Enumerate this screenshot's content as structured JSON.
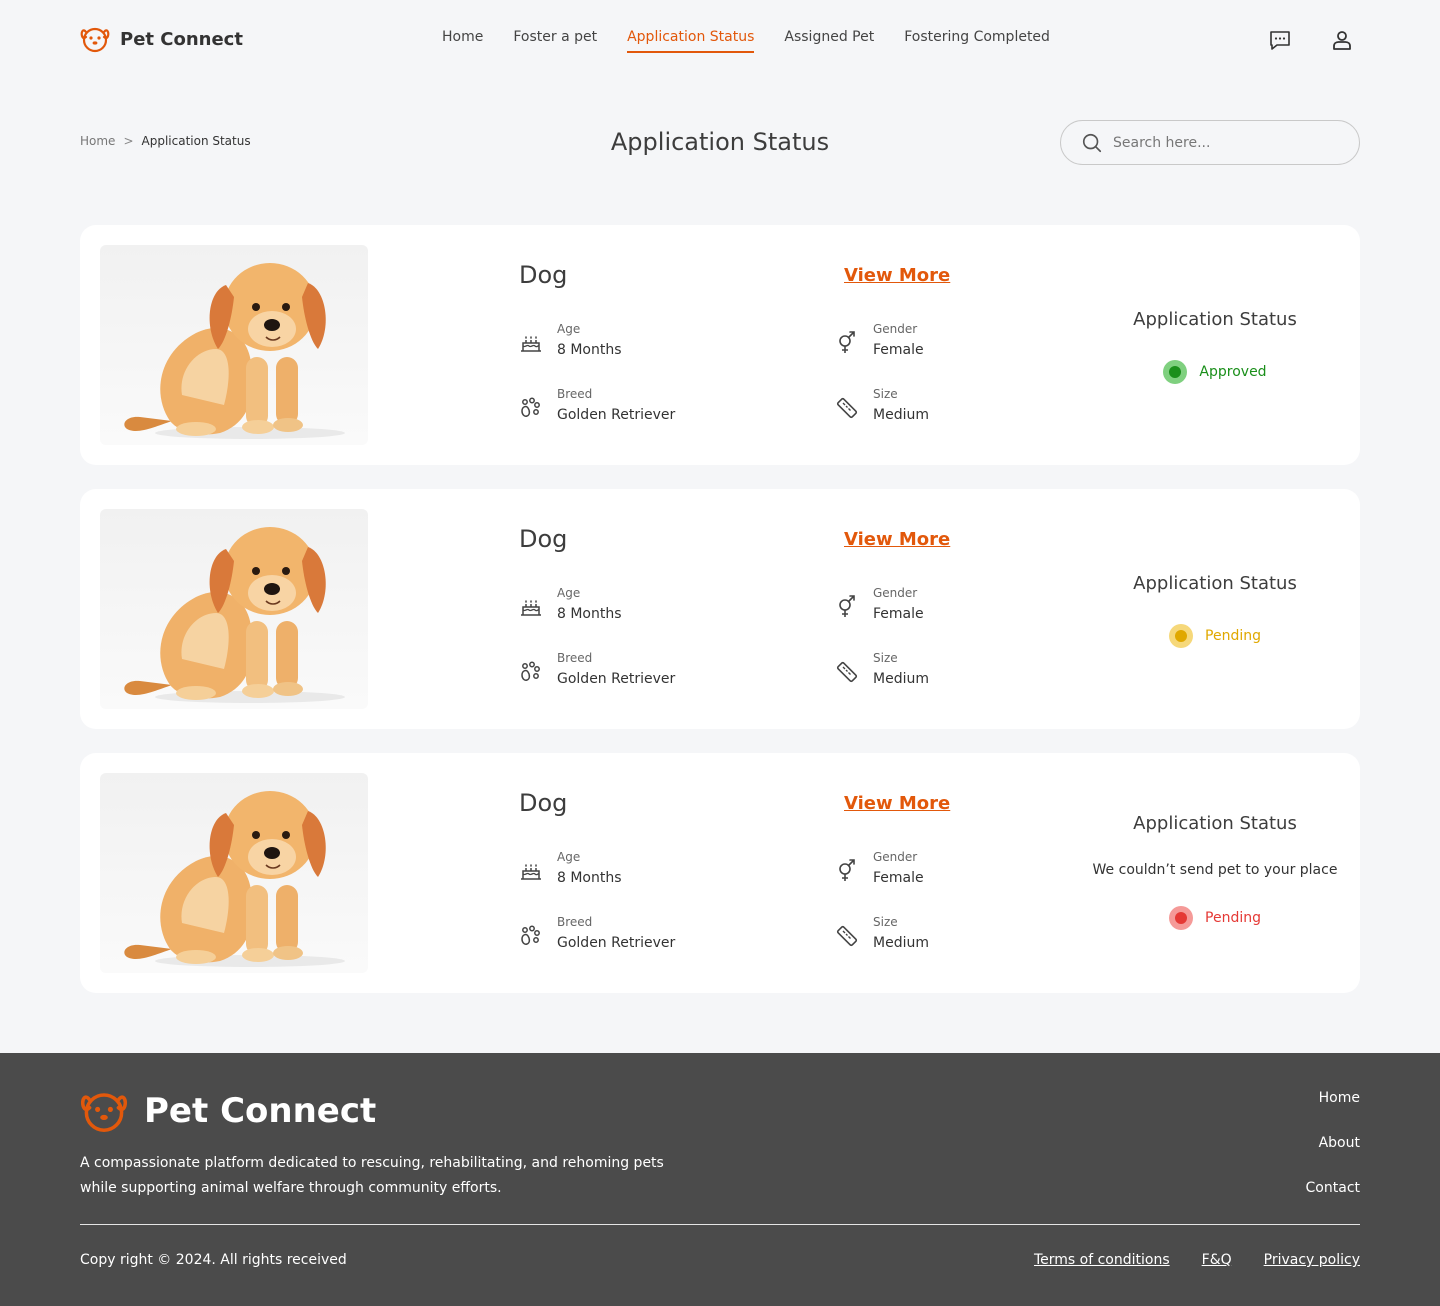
{
  "brand": {
    "name": "Pet Connect",
    "accent": "#e2580b"
  },
  "nav": {
    "items": [
      "Home",
      "Foster a pet",
      "Application Status",
      "Assigned Pet",
      "Fostering Completed"
    ],
    "active": "Application Status"
  },
  "header_icons": [
    "chat-icon",
    "user-icon"
  ],
  "breadcrumb": {
    "home": "Home",
    "separator": ">",
    "current": "Application Status"
  },
  "page_title": "Application Status",
  "search": {
    "placeholder": "Search here..."
  },
  "labels": {
    "age": "Age",
    "breed": "Breed",
    "gender": "Gender",
    "size": "Size",
    "view_more": "View More",
    "status_title": "Application Status"
  },
  "applications": [
    {
      "name": "Dog",
      "age": "8 Months",
      "breed": "Golden Retriever",
      "gender": "Female",
      "size": "Medium",
      "status": "Approved",
      "status_color": "#1a8f1a",
      "status_ring": "#7fd07f",
      "message": ""
    },
    {
      "name": "Dog",
      "age": "8 Months",
      "breed": "Golden Retriever",
      "gender": "Female",
      "size": "Medium",
      "status": "Pending",
      "status_color": "#e0a800",
      "status_ring": "#f6d87a",
      "message": ""
    },
    {
      "name": "Dog",
      "age": "8 Months",
      "breed": "Golden Retriever",
      "gender": "Female",
      "size": "Medium",
      "status": "Pending",
      "status_color": "#e53935",
      "status_ring": "#f59a98",
      "message": "We couldn’t send pet to your place"
    }
  ],
  "footer": {
    "brand": "Pet Connect",
    "description": "A compassionate platform dedicated to rescuing, rehabilitating, and rehoming pets while supporting animal welfare through community efforts.",
    "links": [
      "Home",
      "About",
      "Contact"
    ],
    "copyright": "Copy right © 2024. All rights received",
    "legal": [
      "Terms of conditions",
      "F&Q",
      "Privacy policy"
    ]
  }
}
